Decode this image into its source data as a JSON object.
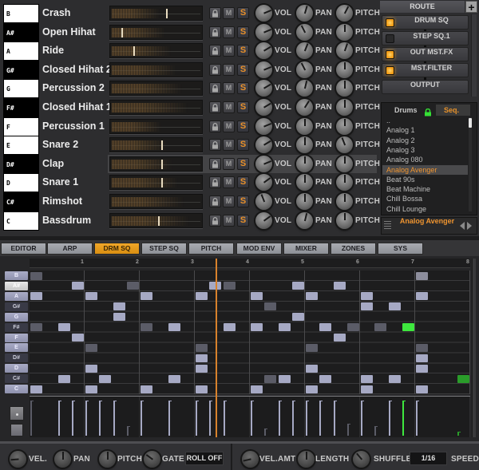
{
  "colors": {
    "note_on": "#a6a9c4",
    "note_dim": "#5b5c67",
    "note_mid": "#8c8d9c",
    "note_green": "#3ee83e",
    "note_green_dark": "#2a9c2a",
    "playhead": "#d8822c",
    "accent": "#e8962a",
    "led_on": "#f2a41e"
  },
  "instruments": [
    {
      "key": "B",
      "black": false,
      "name": "Crash",
      "marker": 0.61,
      "vol": 0.75,
      "pan": 0.56,
      "pitch": 0.6,
      "selected": false
    },
    {
      "key": "A#",
      "black": true,
      "name": "Open Hihat",
      "marker": 0.11,
      "vol": 0.75,
      "pan": 0.4,
      "pitch": 0.5,
      "selected": false
    },
    {
      "key": "A",
      "black": false,
      "name": "Ride",
      "marker": 0.24,
      "vol": 0.72,
      "pan": 0.58,
      "pitch": 0.57,
      "selected": false
    },
    {
      "key": "G#",
      "black": true,
      "name": "Closed Hihat 2",
      "marker": null,
      "vol": 0.75,
      "pan": 0.4,
      "pitch": 0.5,
      "selected": false
    },
    {
      "key": "G",
      "black": false,
      "name": "Percussion 2",
      "marker": null,
      "vol": 0.72,
      "pan": 0.55,
      "pitch": 0.5,
      "selected": false
    },
    {
      "key": "F#",
      "black": true,
      "name": "Closed Hihat 1",
      "marker": null,
      "vol": 0.72,
      "pan": 0.62,
      "pitch": 0.5,
      "selected": false
    },
    {
      "key": "F",
      "black": false,
      "name": "Percussion 1",
      "marker": null,
      "vol": 0.75,
      "pan": 0.5,
      "pitch": 0.5,
      "selected": false
    },
    {
      "key": "E",
      "black": false,
      "name": "Snare 2",
      "marker": 0.55,
      "vol": 0.72,
      "pan": 0.5,
      "pitch": 0.42,
      "selected": false
    },
    {
      "key": "D#",
      "black": true,
      "name": "Clap",
      "marker": 0.55,
      "vol": 0.75,
      "pan": 0.5,
      "pitch": 0.5,
      "selected": true
    },
    {
      "key": "D",
      "black": false,
      "name": "Snare 1",
      "marker": 0.55,
      "vol": 0.7,
      "pan": 0.5,
      "pitch": 0.5,
      "selected": false
    },
    {
      "key": "C#",
      "black": true,
      "name": "Rimshot",
      "marker": null,
      "vol": 0.42,
      "pan": 0.5,
      "pitch": 0.5,
      "selected": false
    },
    {
      "key": "C",
      "black": false,
      "name": "Bassdrum",
      "marker": 0.52,
      "vol": 0.7,
      "pan": 0.55,
      "pitch": 0.5,
      "selected": false
    }
  ],
  "row_controls": {
    "lock_icon": "lock-icon",
    "mute_label": "M",
    "solo_label": "S",
    "vol_label": "VOL",
    "pan_label": "PAN",
    "pitch_label": "PITCH"
  },
  "route": {
    "title": "ROUTE",
    "add_label": "+",
    "items": [
      {
        "label": "DRUM SQ",
        "led": "on"
      },
      {
        "label": "STEP SQ.1",
        "led": "off"
      },
      {
        "label": "OUT MST.FX",
        "led": "on"
      },
      {
        "label": "MST.FILTER",
        "led": "on"
      },
      {
        "label": "OUTPUT",
        "led": "none"
      }
    ]
  },
  "browser": {
    "tab_left": "Drums",
    "tab_right": "Seq.",
    "items": [
      "..",
      "Analog 1",
      "Analog 2",
      "Analog 3",
      "Analog 080",
      "Analog Avenger",
      "Beat 90s",
      "Beat Machine",
      "Chill Bossa",
      "Chill Lounge"
    ],
    "selected_index": 5,
    "current": "Analog Avenger"
  },
  "tabs": [
    {
      "label": "EDITOR",
      "active": false
    },
    {
      "label": "ARP",
      "active": false
    },
    {
      "label": "DRM SQ",
      "active": true
    },
    {
      "label": "STEP SQ",
      "active": false
    },
    {
      "label": "PITCH",
      "active": false
    },
    {
      "label": "MOD ENV",
      "active": false
    },
    {
      "label": "MIXER",
      "active": false
    },
    {
      "label": "ZONES",
      "active": false
    },
    {
      "label": "SYS",
      "active": false
    }
  ],
  "sequencer": {
    "steps": 32,
    "bar_labels": [
      "1",
      "2",
      "3",
      "4",
      "5",
      "6",
      "7",
      "8"
    ],
    "playhead_step": 13.5,
    "rows": [
      {
        "key": "B",
        "black": false,
        "active": false,
        "notes": [
          [
            0,
            "dim"
          ],
          [
            28,
            "mid"
          ]
        ]
      },
      {
        "key": "A#",
        "black": true,
        "active": true,
        "notes": [
          [
            3,
            "on"
          ],
          [
            7,
            "dim"
          ],
          [
            13,
            "on"
          ],
          [
            14,
            "dim"
          ],
          [
            19,
            "on"
          ],
          [
            22,
            "on"
          ]
        ]
      },
      {
        "key": "A",
        "black": false,
        "active": false,
        "notes": [
          [
            0,
            "on"
          ],
          [
            4,
            "on"
          ],
          [
            8,
            "on"
          ],
          [
            12,
            "on"
          ],
          [
            16,
            "on"
          ],
          [
            20,
            "on"
          ],
          [
            24,
            "on"
          ],
          [
            28,
            "on"
          ]
        ]
      },
      {
        "key": "G#",
        "black": true,
        "active": false,
        "notes": [
          [
            6,
            "on"
          ],
          [
            17,
            "dim"
          ],
          [
            24,
            "on"
          ],
          [
            26,
            "on"
          ]
        ]
      },
      {
        "key": "G",
        "black": false,
        "active": false,
        "notes": [
          [
            6,
            "on"
          ],
          [
            19,
            "on"
          ]
        ]
      },
      {
        "key": "F#",
        "black": true,
        "active": false,
        "notes": [
          [
            0,
            "dim"
          ],
          [
            2,
            "on"
          ],
          [
            8,
            "dim"
          ],
          [
            10,
            "on"
          ],
          [
            14,
            "on"
          ],
          [
            16,
            "on"
          ],
          [
            18,
            "on"
          ],
          [
            21,
            "on"
          ],
          [
            23,
            "dim"
          ],
          [
            25,
            "dim"
          ],
          [
            27,
            "green"
          ]
        ]
      },
      {
        "key": "F",
        "black": false,
        "active": false,
        "notes": [
          [
            3,
            "on"
          ],
          [
            22,
            "on"
          ]
        ]
      },
      {
        "key": "E",
        "black": false,
        "active": false,
        "notes": [
          [
            4,
            "dim"
          ],
          [
            12,
            "dim"
          ],
          [
            20,
            "dim"
          ],
          [
            28,
            "dim"
          ]
        ]
      },
      {
        "key": "D#",
        "black": true,
        "active": false,
        "notes": [
          [
            12,
            "on"
          ],
          [
            28,
            "on"
          ]
        ]
      },
      {
        "key": "D",
        "black": false,
        "active": false,
        "notes": [
          [
            4,
            "on"
          ],
          [
            12,
            "on"
          ],
          [
            20,
            "on"
          ],
          [
            28,
            "on"
          ]
        ]
      },
      {
        "key": "C#",
        "black": true,
        "active": false,
        "notes": [
          [
            2,
            "on"
          ],
          [
            5,
            "on"
          ],
          [
            10,
            "on"
          ],
          [
            17,
            "dim"
          ],
          [
            18,
            "on"
          ],
          [
            21,
            "on"
          ],
          [
            24,
            "on"
          ],
          [
            26,
            "on"
          ],
          [
            31,
            "green_dark"
          ]
        ]
      },
      {
        "key": "C",
        "black": false,
        "active": false,
        "notes": [
          [
            0,
            "on"
          ],
          [
            4,
            "on"
          ],
          [
            8,
            "on"
          ],
          [
            12,
            "on"
          ],
          [
            16,
            "on"
          ],
          [
            20,
            "on"
          ],
          [
            24,
            "on"
          ],
          [
            28,
            "on"
          ]
        ]
      }
    ],
    "velocity": [
      [
        0,
        1.0,
        "dim"
      ],
      [
        2,
        1.0,
        "on"
      ],
      [
        3,
        1.0,
        "on"
      ],
      [
        4,
        1.0,
        "on"
      ],
      [
        5,
        1.0,
        "on"
      ],
      [
        6,
        1.0,
        "on"
      ],
      [
        7,
        0.27,
        "dim"
      ],
      [
        8,
        1.0,
        "on"
      ],
      [
        10,
        1.0,
        "on"
      ],
      [
        12,
        1.0,
        "on"
      ],
      [
        13,
        1.0,
        "on"
      ],
      [
        14,
        1.0,
        "on"
      ],
      [
        16,
        1.0,
        "on"
      ],
      [
        17,
        0.2,
        "dim"
      ],
      [
        18,
        1.0,
        "on"
      ],
      [
        19,
        1.0,
        "on"
      ],
      [
        20,
        1.0,
        "on"
      ],
      [
        21,
        1.0,
        "on"
      ],
      [
        22,
        1.0,
        "on"
      ],
      [
        23,
        0.35,
        "dim"
      ],
      [
        24,
        1.0,
        "on"
      ],
      [
        25,
        0.27,
        "dim"
      ],
      [
        26,
        1.0,
        "on"
      ],
      [
        27,
        1.0,
        "green"
      ],
      [
        28,
        1.0,
        "on"
      ],
      [
        31,
        0.12,
        "green_dark"
      ]
    ]
  },
  "bottom": {
    "knobs_left": [
      {
        "label": "VEL.",
        "value": 0.15
      },
      {
        "label": "PAN",
        "value": 0.5
      },
      {
        "label": "PITCH",
        "value": 0.5
      },
      {
        "label": "GATE",
        "value": 0.3
      }
    ],
    "roll_label": "ROLL OFF",
    "knobs_right": [
      {
        "label": "VEL.AMT",
        "value": 0.12
      },
      {
        "label": "LENGTH",
        "value": 0.5
      },
      {
        "label": "SHUFFLE",
        "value": 0.35
      }
    ],
    "speed_value": "1/16",
    "speed_label": "SPEED"
  }
}
